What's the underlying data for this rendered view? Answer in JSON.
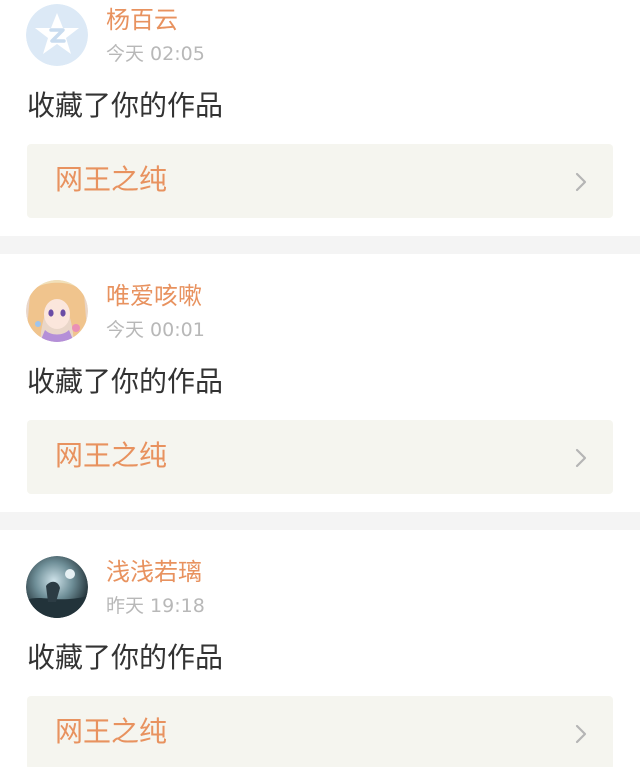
{
  "notifications": [
    {
      "username": "杨百云",
      "time": "今天 02:05",
      "action": "收藏了你的作品",
      "work_title": "网王之纯",
      "avatar": "default-star-avatar"
    },
    {
      "username": "唯爱咳嗽",
      "time": "今天 00:01",
      "action": "收藏了你的作品",
      "work_title": "网王之纯",
      "avatar": "anime-girl-avatar"
    },
    {
      "username": "浅浅若璃",
      "time": "昨天 19:18",
      "action": "收藏了你的作品",
      "work_title": "网王之纯",
      "avatar": "night-scene-avatar"
    }
  ],
  "colors": {
    "accent": "#e8925f",
    "time": "#b8b8b8",
    "text": "#333333",
    "work_bg": "#f5f5ef",
    "divider": "#f4f4f4"
  }
}
